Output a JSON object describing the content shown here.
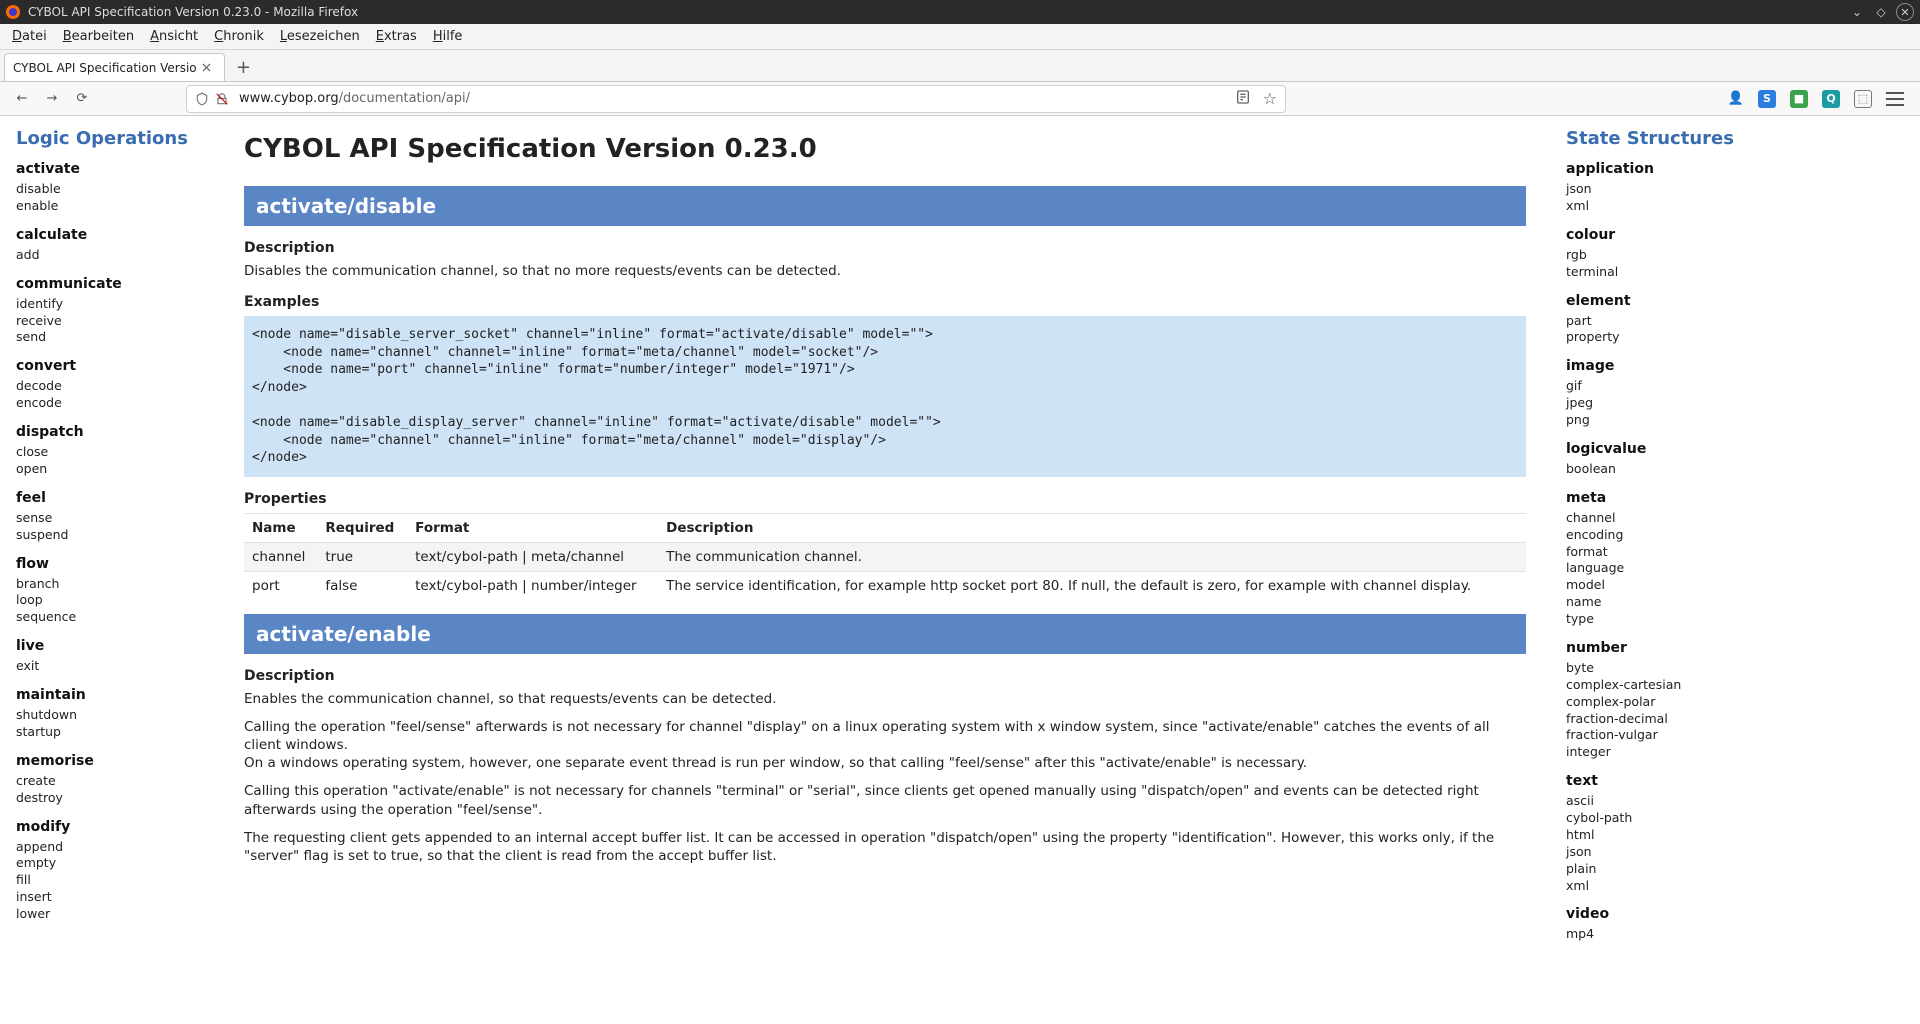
{
  "window": {
    "title": "CYBOL API Specification Version 0.23.0 - Mozilla Firefox"
  },
  "menubar": [
    "Datei",
    "Bearbeiten",
    "Ansicht",
    "Chronik",
    "Lesezeichen",
    "Extras",
    "Hilfe"
  ],
  "tab": {
    "title": "CYBOL API Specification Versio"
  },
  "url": {
    "host": "www.cybop.org",
    "path": "/documentation/api/"
  },
  "left": {
    "heading": "Logic Operations",
    "groups": [
      {
        "name": "activate",
        "items": [
          "disable",
          "enable"
        ]
      },
      {
        "name": "calculate",
        "items": [
          "add"
        ]
      },
      {
        "name": "communicate",
        "items": [
          "identify",
          "receive",
          "send"
        ]
      },
      {
        "name": "convert",
        "items": [
          "decode",
          "encode"
        ]
      },
      {
        "name": "dispatch",
        "items": [
          "close",
          "open"
        ]
      },
      {
        "name": "feel",
        "items": [
          "sense",
          "suspend"
        ]
      },
      {
        "name": "flow",
        "items": [
          "branch",
          "loop",
          "sequence"
        ]
      },
      {
        "name": "live",
        "items": [
          "exit"
        ]
      },
      {
        "name": "maintain",
        "items": [
          "shutdown",
          "startup"
        ]
      },
      {
        "name": "memorise",
        "items": [
          "create",
          "destroy"
        ]
      },
      {
        "name": "modify",
        "items": [
          "append",
          "empty",
          "fill",
          "insert",
          "lower"
        ]
      }
    ]
  },
  "right": {
    "heading": "State Structures",
    "groups": [
      {
        "name": "application",
        "items": [
          "json",
          "xml"
        ]
      },
      {
        "name": "colour",
        "items": [
          "rgb",
          "terminal"
        ]
      },
      {
        "name": "element",
        "items": [
          "part",
          "property"
        ]
      },
      {
        "name": "image",
        "items": [
          "gif",
          "jpeg",
          "png"
        ]
      },
      {
        "name": "logicvalue",
        "items": [
          "boolean"
        ]
      },
      {
        "name": "meta",
        "items": [
          "channel",
          "encoding",
          "format",
          "language",
          "model",
          "name",
          "type"
        ]
      },
      {
        "name": "number",
        "items": [
          "byte",
          "complex-cartesian",
          "complex-polar",
          "fraction-decimal",
          "fraction-vulgar",
          "integer"
        ]
      },
      {
        "name": "text",
        "items": [
          "ascii",
          "cybol-path",
          "html",
          "json",
          "plain",
          "xml"
        ]
      },
      {
        "name": "video",
        "items": [
          "mp4"
        ]
      }
    ]
  },
  "main": {
    "title": "CYBOL API Specification Version 0.23.0",
    "sections": [
      {
        "bar": "activate/disable",
        "desc_h": "Description",
        "desc": "Disables the communication channel, so that no more requests/events can be detected.",
        "ex_h": "Examples",
        "code": "<node name=\"disable_server_socket\" channel=\"inline\" format=\"activate/disable\" model=\"\">\n    <node name=\"channel\" channel=\"inline\" format=\"meta/channel\" model=\"socket\"/>\n    <node name=\"port\" channel=\"inline\" format=\"number/integer\" model=\"1971\"/>\n</node>\n\n<node name=\"disable_display_server\" channel=\"inline\" format=\"activate/disable\" model=\"\">\n    <node name=\"channel\" channel=\"inline\" format=\"meta/channel\" model=\"display\"/>\n</node>",
        "props_h": "Properties",
        "props_header": [
          "Name",
          "Required",
          "Format",
          "Description"
        ],
        "props": [
          {
            "name": "channel",
            "required": "true",
            "format": "text/cybol-path | meta/channel",
            "desc": "The communication channel."
          },
          {
            "name": "port",
            "required": "false",
            "format": "text/cybol-path | number/integer",
            "desc": "The service identification, for example http socket port 80. If null, the default is zero, for example with channel display."
          }
        ]
      },
      {
        "bar": "activate/enable",
        "desc_h": "Description",
        "paras": [
          "Enables the communication channel, so that requests/events can be detected.",
          "Calling the operation \"feel/sense\" afterwards is not necessary for channel \"display\" on a linux operating system with x window system, since \"activate/enable\" catches the events of all client windows.\nOn a windows operating system, however, one separate event thread is run per window, so that calling \"feel/sense\" after this \"activate/enable\" is necessary.",
          "Calling this operation \"activate/enable\" is not necessary for channels \"terminal\" or \"serial\", since clients get opened manually using \"dispatch/open\" and events can be detected right afterwards using the operation \"feel/sense\".",
          "The requesting client gets appended to an internal accept buffer list. It can be accessed in operation \"dispatch/open\" using the property \"identification\". However, this works only, if the \"server\" flag is set to true, so that the client is read from the accept buffer list."
        ]
      }
    ]
  }
}
